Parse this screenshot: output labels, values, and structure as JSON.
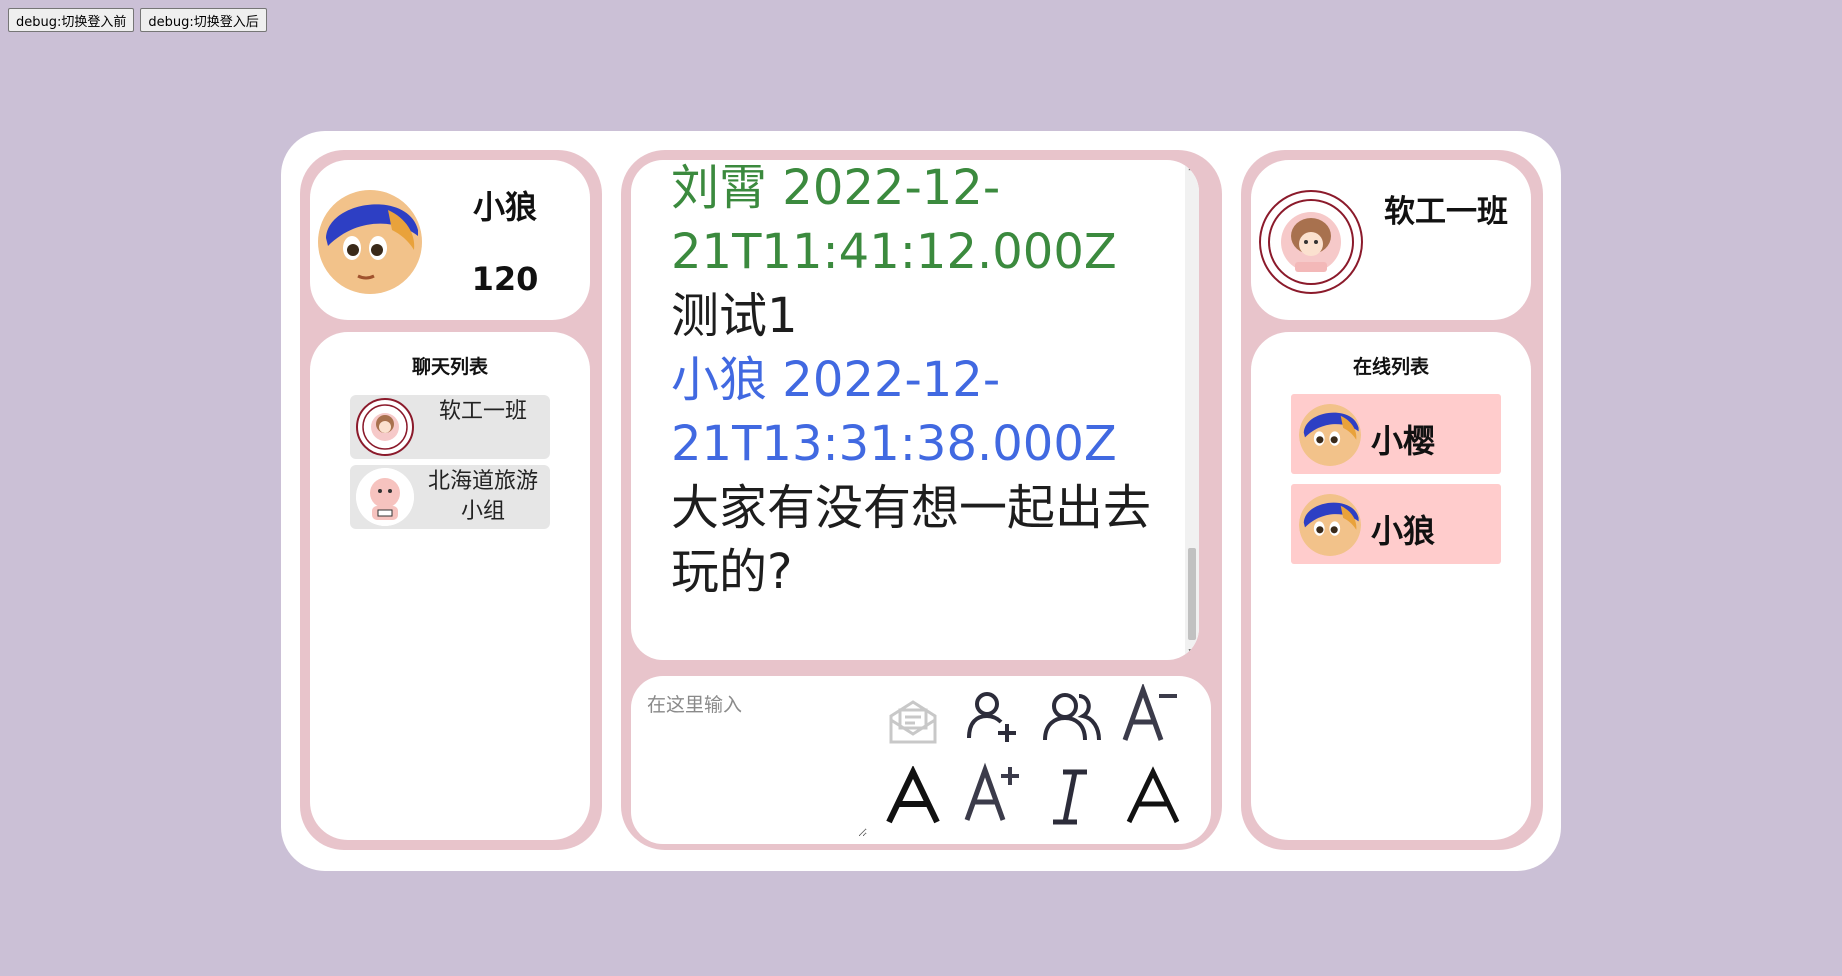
{
  "debug": {
    "btn_before": "debug:切换登入前",
    "btn_after": "debug:切换登入后"
  },
  "profile": {
    "name": "小狼",
    "score": "120",
    "avatar": "boy-blue-hat-avatar"
  },
  "chat_list": {
    "title": "聊天列表",
    "items": [
      {
        "name": "软工一班",
        "avatar": "ccs-rose-badge"
      },
      {
        "name": "北海道旅游小组",
        "avatar": "cartoon-baby-avatar"
      }
    ]
  },
  "messages": [
    {
      "sender": "刘霄",
      "time": "2022-12-21T11:41:12.000Z",
      "text": "测试1",
      "color": "#3b8a3e"
    },
    {
      "sender": "小狼",
      "time": "2022-12-21T13:31:38.000Z",
      "text": "大家有没有想一起出去玩的?",
      "color": "#4169e1"
    }
  ],
  "composer": {
    "placeholder": "在这里输入",
    "tools": [
      "send-mail-icon",
      "add-user-icon",
      "group-icon",
      "font-decrease-icon",
      "font-normal-icon",
      "font-increase-icon",
      "italic-icon",
      "font-regular-icon"
    ]
  },
  "group": {
    "name": "软工一班",
    "avatar": "ccs-rose-badge"
  },
  "online_list": {
    "title": "在线列表",
    "users": [
      {
        "name": "小樱"
      },
      {
        "name": "小狼"
      }
    ]
  },
  "colors": {
    "background": "#cbc0d6",
    "panel_border": "#e8c4cb",
    "online_item": "#ffcccc",
    "sender_green": "#3b8a3e",
    "sender_blue": "#4169e1"
  }
}
